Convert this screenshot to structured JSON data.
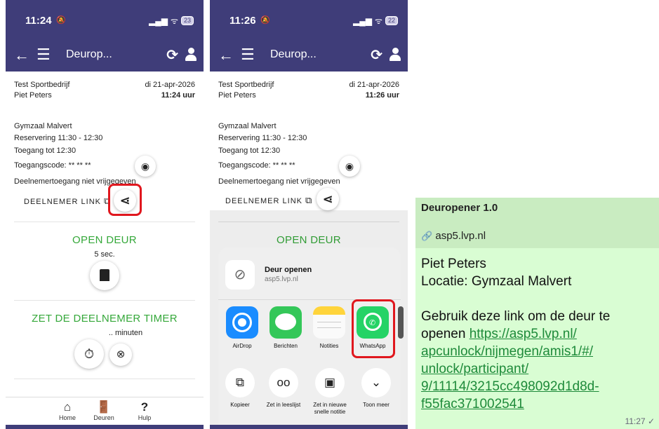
{
  "colors": {
    "header": "#3f3d79",
    "green": "#35a83a",
    "highlight": "#e0171e",
    "link": "#1e8a3a"
  },
  "phone1": {
    "status": {
      "time": "11:24",
      "battery": "23"
    },
    "appbar": {
      "title": "Deurop..."
    },
    "company": "Test Sportbedrijf",
    "date": "di 21-apr-2026",
    "person": "Piet Peters",
    "clock": "11:24 uur",
    "location": "Gymzaal Malvert",
    "reservation": "Reservering 11:30 - 12:30",
    "access_until": "Toegang tot 12:30",
    "access_code": "Toegangscode: ** ** **",
    "participant_access": "Deelnemertoegang niet vrijgegeven",
    "participant_link": "DEELNEMER LINK",
    "open_door": "OPEN DEUR",
    "open_seconds": "5 sec.",
    "timer_title": "ZET DE DEELNEMER TIMER",
    "timer_minutes": ".. minuten",
    "nav": [
      {
        "label": "Home",
        "icon": "home-icon"
      },
      {
        "label": "Deuren",
        "icon": "door-icon"
      },
      {
        "label": "Hulp",
        "icon": "help-icon"
      }
    ]
  },
  "phone2": {
    "status": {
      "time": "11:26",
      "battery": "22"
    },
    "appbar": {
      "title": "Deurop..."
    },
    "company": "Test Sportbedrijf",
    "date": "di 21-apr-2026",
    "person": "Piet Peters",
    "clock": "11:26 uur",
    "location": "Gymzaal Malvert",
    "reservation": "Reservering 11:30 - 12:30",
    "access_until": "Toegang tot 12:30",
    "access_code": "Toegangscode: ** ** **",
    "participant_access": "Deelnemertoegang niet vrijgegeven",
    "participant_link": "DEELNEMER LINK",
    "open_door": "OPEN DEUR",
    "share_sheet": {
      "title": "Deur openen",
      "subtitle": "asp5.lvp.nl",
      "apps": [
        {
          "label": "AirDrop",
          "icon": "airdrop-icon",
          "color": "#1a8cff"
        },
        {
          "label": "Berichten",
          "icon": "messages-icon",
          "color": "#34c759"
        },
        {
          "label": "Notities",
          "icon": "notes-icon",
          "color": "#ffd43b"
        },
        {
          "label": "WhatsApp",
          "icon": "whatsapp-icon",
          "color": "#25d366"
        }
      ],
      "actions": [
        {
          "label": "Kopieer",
          "icon": "copy-icon"
        },
        {
          "label": "Zet in leeslijst",
          "icon": "glasses-icon"
        },
        {
          "label": "Zet in nieuwe snelle notitie",
          "icon": "quick-note-icon"
        },
        {
          "label": "Toon meer",
          "icon": "chevron-down-icon"
        }
      ]
    }
  },
  "chat": {
    "preview_title": "Deuropener 1.0",
    "preview_domain": "asp5.lvp.nl",
    "line1": "Piet Peters",
    "line2": "Locatie: Gymzaal Malvert",
    "line3": "Gebruik deze link om de deur te",
    "line4_prefix": "openen ",
    "url_parts": [
      "https://asp5.lvp.nl/",
      "apcunlock/nijmegen/amis1/#/",
      "unlock/participant/",
      "9/11114/3215cc498092d1d8d-",
      "f55fac371002541"
    ],
    "time": "11:27",
    "check": "✓"
  }
}
